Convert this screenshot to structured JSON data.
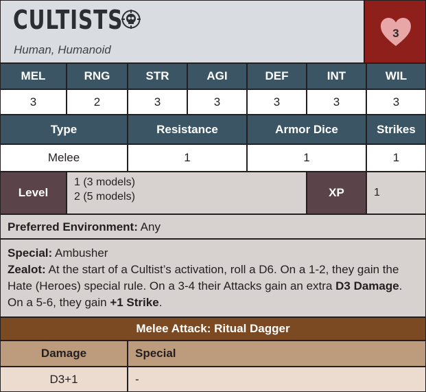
{
  "header": {
    "title": "CULTISTS",
    "subtitle": "Human, Humanoid",
    "health": "3",
    "icon": "skull-icon",
    "heart_icon": "heart-icon"
  },
  "stats": {
    "headers": [
      "MEL",
      "RNG",
      "STR",
      "AGI",
      "DEF",
      "INT",
      "WIL"
    ],
    "values": [
      "3",
      "2",
      "3",
      "3",
      "3",
      "3",
      "3"
    ]
  },
  "combat": {
    "headers": [
      "Type",
      "Resistance",
      "Armor Dice",
      "Strikes"
    ],
    "values": [
      "Melee",
      "1",
      "1",
      "1"
    ]
  },
  "level": {
    "label": "Level",
    "line1": "1 (3 models)",
    "line2": "2 (5 models)",
    "xp_label": "XP",
    "xp_value": "1"
  },
  "environment": {
    "label": "Preferred Environment:",
    "value": " Any"
  },
  "special": {
    "label": "Special:",
    "value": " Ambusher",
    "zealot_label": "Zealot:",
    "zealot_text1": " At the start of a Cultist’s activation, roll a D6. On a 1-2, they gain the Hate (Heroes) special rule. On a 3-4 their Attacks gain an extra ",
    "zealot_bold1": "D3 Damage",
    "zealot_text2": ". On a 5-6, they gain ",
    "zealot_bold2": "+1 Strike",
    "zealot_text3": "."
  },
  "attack": {
    "title": "Melee Attack: Ritual Dagger",
    "headers": [
      "Damage",
      "Special"
    ],
    "values": [
      "D3+1",
      "-"
    ]
  },
  "colors": {
    "header_bg": "#d9dde2",
    "stat_header": "#3c5565",
    "heart_box": "#8e1f1b",
    "heart": "#e8a6a6",
    "level_label": "#5b4449",
    "attack_header": "#7b4a23"
  }
}
